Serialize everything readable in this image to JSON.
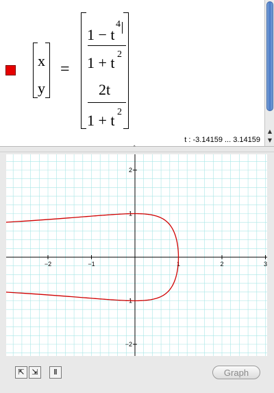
{
  "equation": {
    "lhs_top": "x",
    "lhs_bottom": "y",
    "equals": "=",
    "x_num": "1 − t",
    "x_num_exp": "4",
    "x_den": "1 + t",
    "x_den_exp": "2",
    "y_num": "2t",
    "y_den": "1 + t",
    "y_den_exp": "2",
    "swatch_color": "#e60000"
  },
  "range_label": "t : -3.14159 ... 3.14159",
  "graph": {
    "x_ticks": [
      "−2",
      "−1",
      "1",
      "2",
      "3"
    ],
    "y_ticks": [
      "2",
      "1",
      "−1",
      "−2"
    ],
    "curve_color": "#d00000",
    "grid_color": "#a8e6e6"
  },
  "toolbar": {
    "graph_button": "Graph",
    "zoom_icon_1": "zoom-in-icon",
    "zoom_icon_2": "zoom-out-icon",
    "trace_icon": "trace-icon"
  },
  "icons": {
    "swatch": "color-swatch",
    "scroll_up": "up-arrow-icon",
    "scroll_down": "down-arrow-icon",
    "grip": "splitter-grip-icon"
  }
}
